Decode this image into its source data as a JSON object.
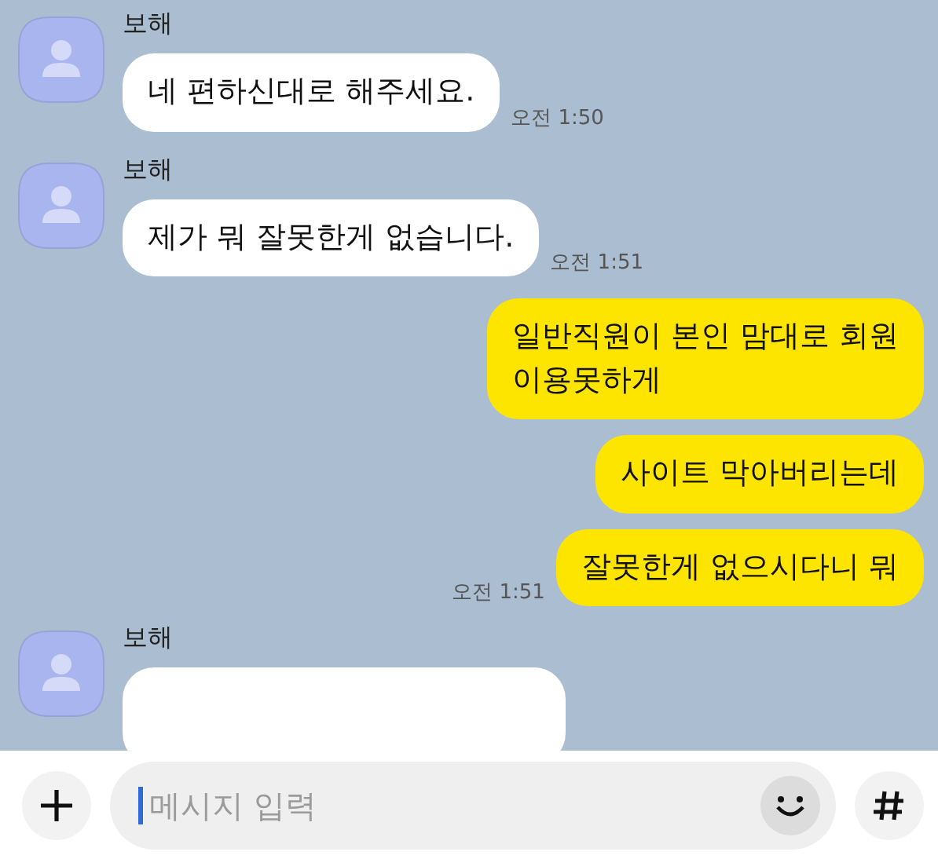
{
  "messages": [
    {
      "kind": "received",
      "sender": "보해",
      "text": "네 편하신대로 해주세요.",
      "time": "오전 1:50"
    },
    {
      "kind": "received",
      "sender": "보해",
      "text": "제가 뭐 잘못한게 없습니다.",
      "time": "오전 1:51"
    },
    {
      "kind": "sent",
      "text": "일반직원이 본인 맘대로 회원\n이용못하게"
    },
    {
      "kind": "sent",
      "text": "사이트 막아버리는데"
    },
    {
      "kind": "sent",
      "text": "잘못한게 없으시다니 뭐",
      "time": "오전 1:51"
    },
    {
      "kind": "received",
      "sender": "보해"
    }
  ],
  "composer": {
    "placeholder": "메시지 입력"
  }
}
